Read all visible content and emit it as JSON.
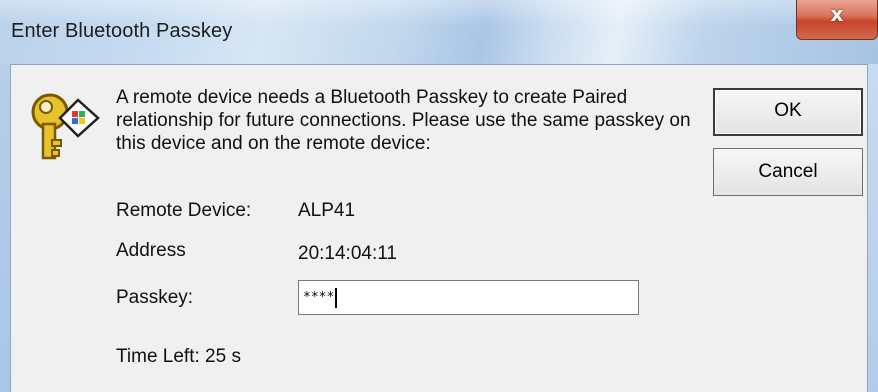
{
  "window": {
    "title": "Enter Bluetooth Passkey",
    "close_glyph": "x"
  },
  "message": "A remote device needs a Bluetooth Passkey to create Paired relationship for future connections. Please use the same passkey on this device and on the remote device:",
  "fields": {
    "remote_device_label": "Remote Device:",
    "remote_device_value": "ALP41",
    "address_label": "Address",
    "address_value": "20:14:04:11",
    "passkey_label": "Passkey:",
    "passkey_value": "****",
    "time_left": "Time Left: 25 s"
  },
  "buttons": {
    "ok_label": "OK",
    "cancel_label": "Cancel"
  },
  "icons": {
    "dialog_icon": "key-icon",
    "close_icon": "close-icon"
  },
  "colors": {
    "close_button": "#c7452a",
    "titlebar": "#b9d1ea",
    "dialog_background": "#f0f0f0"
  }
}
